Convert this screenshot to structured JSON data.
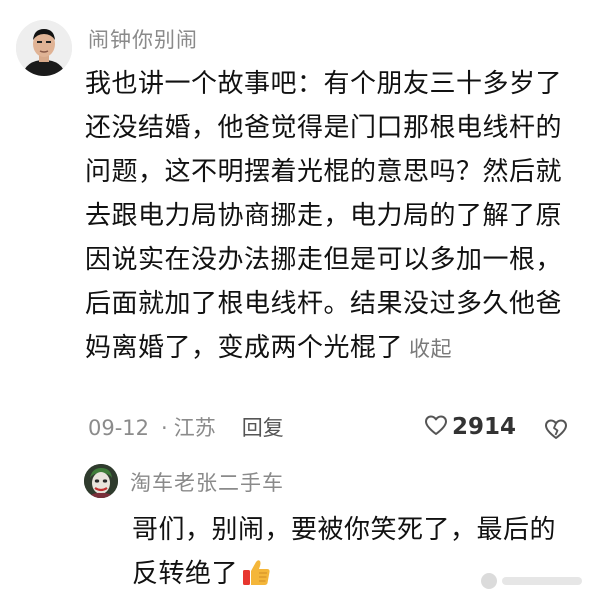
{
  "comment": {
    "username": "闹钟你别闹",
    "text": "我也讲一个故事吧：有个朋友三十多岁了还没结婚，他爸觉得是门口那根电线杆的问题，这不明摆着光棍的意思吗？然后就去跟电力局协商挪走，电力局的了解了原因说实在没办法挪走但是可以多加一根，后面就加了根电线杆。结果没过多久他爸妈离婚了，变成两个光棍了",
    "collapse_label": "收起",
    "date": "09-12",
    "separator": "·",
    "region": "江苏",
    "reply_label": "回复",
    "like_count": "2914",
    "icons": {
      "like": "heart-outline-icon",
      "dislike": "broken-heart-icon"
    }
  },
  "reply": {
    "username": "淘车老张二手车",
    "text": "哥们，别闹，要被你笑死了，最后的反转绝了",
    "emoji": "thumbs-up-emoji"
  },
  "colors": {
    "meta_gray": "#8b8b8b",
    "text": "#111111",
    "thumb": "#f4b63a"
  }
}
